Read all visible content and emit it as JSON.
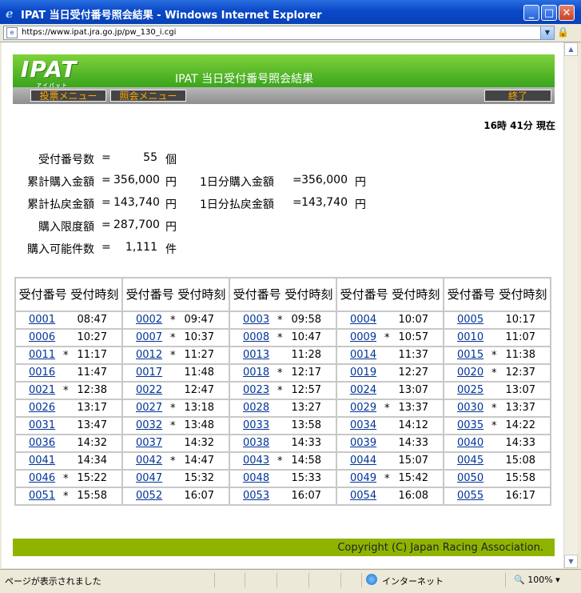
{
  "window": {
    "title": "IPAT  当日受付番号照会結果 - Windows Internet Explorer"
  },
  "address": {
    "url": "https://www.ipat.jra.go.jp/pw_130_i.cgi"
  },
  "header": {
    "logo": "IPAT",
    "logo_sub": "アイパット",
    "title": "IPAT  当日受付番号照会結果"
  },
  "menu": {
    "vote": "投票メニュー",
    "inquiry": "照会メニュー",
    "exit": "終了"
  },
  "time_label": "16時 41分 現在",
  "summary": {
    "count_label": "受付番号数",
    "count_value": "55",
    "count_unit": "個",
    "total_buy_label": "累計購入金額",
    "total_buy_value": "356,000",
    "yen": "円",
    "day_buy_label": "1日分購入金額",
    "day_buy_value": "356,000",
    "total_refund_label": "累計払戻金額",
    "total_refund_value": "143,740",
    "day_refund_label": "1日分払戻金額",
    "day_refund_value": "143,740",
    "limit_label": "購入限度額",
    "limit_value": "287,700",
    "possible_label": "購入可能件数",
    "possible_value": "1,111",
    "possible_unit": "件",
    "eq": "="
  },
  "table": {
    "header": "受付番号 受付時刻",
    "rows": [
      [
        [
          "0001",
          "",
          "08:47"
        ],
        [
          "0002",
          "*",
          "09:47"
        ],
        [
          "0003",
          "*",
          "09:58"
        ],
        [
          "0004",
          "",
          "10:07"
        ],
        [
          "0005",
          "",
          "10:17"
        ]
      ],
      [
        [
          "0006",
          "",
          "10:27"
        ],
        [
          "0007",
          "*",
          "10:37"
        ],
        [
          "0008",
          "*",
          "10:47"
        ],
        [
          "0009",
          "*",
          "10:57"
        ],
        [
          "0010",
          "",
          "11:07"
        ]
      ],
      [
        [
          "0011",
          "*",
          "11:17"
        ],
        [
          "0012",
          "*",
          "11:27"
        ],
        [
          "0013",
          "",
          "11:28"
        ],
        [
          "0014",
          "",
          "11:37"
        ],
        [
          "0015",
          "*",
          "11:38"
        ]
      ],
      [
        [
          "0016",
          "",
          "11:47"
        ],
        [
          "0017",
          "",
          "11:48"
        ],
        [
          "0018",
          "*",
          "12:17"
        ],
        [
          "0019",
          "",
          "12:27"
        ],
        [
          "0020",
          "*",
          "12:37"
        ]
      ],
      [
        [
          "0021",
          "*",
          "12:38"
        ],
        [
          "0022",
          "",
          "12:47"
        ],
        [
          "0023",
          "*",
          "12:57"
        ],
        [
          "0024",
          "",
          "13:07"
        ],
        [
          "0025",
          "",
          "13:07"
        ]
      ],
      [
        [
          "0026",
          "",
          "13:17"
        ],
        [
          "0027",
          "*",
          "13:18"
        ],
        [
          "0028",
          "",
          "13:27"
        ],
        [
          "0029",
          "*",
          "13:37"
        ],
        [
          "0030",
          "*",
          "13:37"
        ]
      ],
      [
        [
          "0031",
          "",
          "13:47"
        ],
        [
          "0032",
          "*",
          "13:48"
        ],
        [
          "0033",
          "",
          "13:58"
        ],
        [
          "0034",
          "",
          "14:12"
        ],
        [
          "0035",
          "*",
          "14:22"
        ]
      ],
      [
        [
          "0036",
          "",
          "14:32"
        ],
        [
          "0037",
          "",
          "14:32"
        ],
        [
          "0038",
          "",
          "14:33"
        ],
        [
          "0039",
          "",
          "14:33"
        ],
        [
          "0040",
          "",
          "14:33"
        ]
      ],
      [
        [
          "0041",
          "",
          "14:34"
        ],
        [
          "0042",
          "*",
          "14:47"
        ],
        [
          "0043",
          "*",
          "14:58"
        ],
        [
          "0044",
          "",
          "15:07"
        ],
        [
          "0045",
          "",
          "15:08"
        ]
      ],
      [
        [
          "0046",
          "*",
          "15:22"
        ],
        [
          "0047",
          "",
          "15:32"
        ],
        [
          "0048",
          "",
          "15:33"
        ],
        [
          "0049",
          "*",
          "15:42"
        ],
        [
          "0050",
          "",
          "15:58"
        ]
      ],
      [
        [
          "0051",
          "*",
          "15:58"
        ],
        [
          "0052",
          "",
          "16:07"
        ],
        [
          "0053",
          "",
          "16:07"
        ],
        [
          "0054",
          "",
          "16:08"
        ],
        [
          "0055",
          "",
          "16:17"
        ]
      ]
    ]
  },
  "footer": {
    "copyright": "Copyright (C) Japan Racing Association."
  },
  "status": {
    "text": "ページが表示されました",
    "zone": "インターネット",
    "zoom": "100%"
  }
}
